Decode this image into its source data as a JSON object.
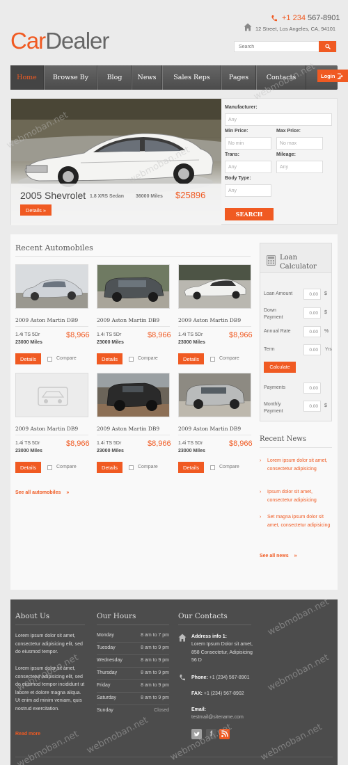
{
  "header": {
    "logo_part1": "Car",
    "logo_part2": "Dealer",
    "phone_accent": "+1 234",
    "phone_rest": "567-8901",
    "address": "12 Street, Los Angeles, CA, 94101",
    "search_placeholder": "Search"
  },
  "nav": {
    "items": [
      "Home",
      "Browse By",
      "Blog",
      "News",
      "Sales Reps",
      "Pages",
      "Contacts"
    ],
    "active": "Home",
    "login": "Login"
  },
  "hero": {
    "title": "2005 Shevrolet",
    "subtitle": "1.8 XRS Sedan",
    "miles": "36000 Miles",
    "price": "$25896",
    "details": "Details »"
  },
  "search_form": {
    "manufacturer_label": "Manufacturer:",
    "manufacturer_value": "Any",
    "min_price_label": "Min Price:",
    "min_price_value": "No min",
    "max_price_label": "Max Price:",
    "max_price_value": "No max",
    "trans_label": "Trans:",
    "trans_value": "Any",
    "mileage_label": "Mileage:",
    "mileage_value": "Any",
    "body_label": "Body Type:",
    "body_value": "Any",
    "search_button": "SEARCH"
  },
  "recent": {
    "title": "Recent Automobiles",
    "see_all": "See all automobiles",
    "details_label": "Details",
    "compare_label": "Compare",
    "cars": [
      {
        "title": "2009 Aston Martin DB9",
        "spec": "1.4i TS 5Dr",
        "miles": "23000 Miles",
        "price": "$8,966"
      },
      {
        "title": "2009 Aston Martin DB9",
        "spec": "1.4i TS 5Dr",
        "miles": "23000 Miles",
        "price": "$8,966"
      },
      {
        "title": "2009 Aston Martin DB9",
        "spec": "1.4i TS 5Dr",
        "miles": "23000 Miles",
        "price": "$8,966"
      },
      {
        "title": "2009 Aston Martin DB9",
        "spec": "1.4i TS 5Dr",
        "miles": "23000 Miles",
        "price": "$8,966"
      },
      {
        "title": "2009 Aston Martin DB9",
        "spec": "1.4i TS 5Dr",
        "miles": "23000 Miles",
        "price": "$8,966"
      },
      {
        "title": "2009 Aston Martin DB9",
        "spec": "1.4i TS 5Dr",
        "miles": "23000 Miles",
        "price": "$8,966"
      }
    ]
  },
  "loan": {
    "title_line1": "Loan",
    "title_line2": "Calculator",
    "loan_amount_label": "Loan Amount",
    "loan_amount_value": "0.00",
    "loan_amount_unit": "$",
    "down_payment_label_1": "Down",
    "down_payment_label_2": "Payment",
    "down_payment_value": "0.00",
    "down_payment_unit": "$",
    "annual_rate_label": "Annual Rate",
    "annual_rate_value": "0.00",
    "annual_rate_unit": "%",
    "term_label": "Term",
    "term_value": "0.00",
    "term_unit": "Yrs",
    "calculate": "Calculate",
    "payments_label": "Payments",
    "payments_value": "0.00",
    "monthly_label_1": "Monthly",
    "monthly_label_2": "Payment",
    "monthly_value": "0.00",
    "monthly_unit": "$"
  },
  "news": {
    "title": "Recent News",
    "items": [
      "Lorem ipsum dolor sit amet, consectetur adipisicing",
      "Ipsum dolor sit amet, consectetur adipisicing",
      "Set magna ipsum dolor sit amet, consectetur adipisicing"
    ],
    "see_all": "See all news"
  },
  "footer": {
    "about_title": "About Us",
    "about_p1": "Lorem ipsum dolor sit amet, consectetur adipisicing elit, sed do eiusmod tempor.",
    "about_p2": "Lorem ipsum dolor sit amet, consectetur adipisicing elit, sed do eiusmod tempor incididunt ut labore et dolore magna aliqua. Ut enim ad minim veniam, quis nostrud exercitation.",
    "read_more": "Read more",
    "hours_title": "Our Hours",
    "hours": [
      {
        "day": "Monday",
        "time": "8 am to 7 pm"
      },
      {
        "day": "Tuesday",
        "time": "8 am to 9 pm"
      },
      {
        "day": "Wednesday",
        "time": "8 am to 9 pm"
      },
      {
        "day": "Thursday",
        "time": "8 am to 9 pm"
      },
      {
        "day": "Friday",
        "time": "8 am to 9 pm"
      },
      {
        "day": "Saturday",
        "time": "8 am to 9 pm"
      },
      {
        "day": "Sunday",
        "time": "Closed"
      }
    ],
    "contacts_title": "Our Contacts",
    "address_label": "Address info 1:",
    "address_text": "Lorem Ipsum Dolor sit amet, 858 Consectetur, Adipisicing 56 D",
    "phone_label": "Phone:",
    "phone_value": "+1 (234) 567-8901",
    "fax_label": "FAX:",
    "fax_value": "+1 (234) 567-8902",
    "email_label": "Email:",
    "email_value": "testmail@sitename.com"
  },
  "watermark": "webmoban.net",
  "colors": {
    "accent": "#f05a22",
    "nav_bg": "#555555",
    "footer_bg": "#4c4c4c",
    "page_bg": "#ebebeb"
  },
  "icons": [
    "phone-icon",
    "home-icon",
    "search-icon",
    "login-icon",
    "loan-calculator-icon",
    "twitter-icon",
    "facebook-icon",
    "rss-icon"
  ]
}
